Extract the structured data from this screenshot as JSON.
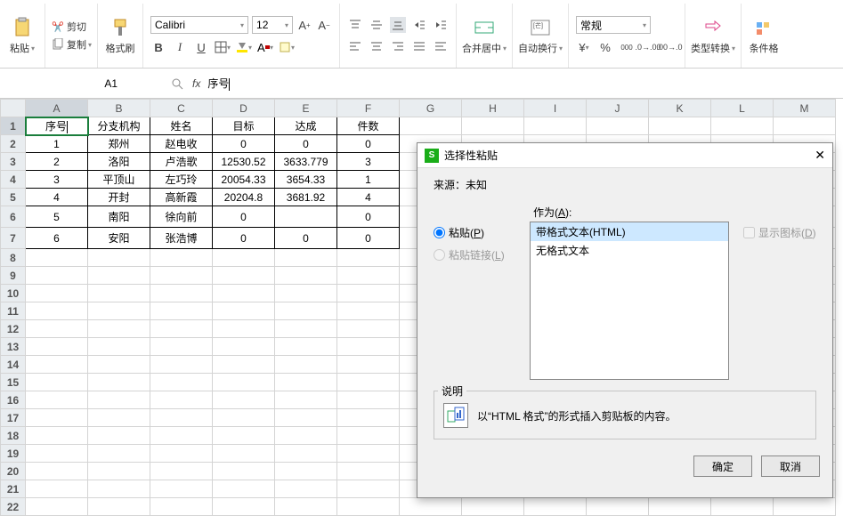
{
  "ribbon": {
    "paste_label": "粘贴",
    "cut_label": "剪切",
    "copy_label": "复制",
    "format_painter_label": "格式刷",
    "font_name": "Calibri",
    "font_size": "12",
    "merge_center_label": "合并居中",
    "wrap_text_label": "自动换行",
    "number_format_label": "常规",
    "type_convert_label": "类型转换",
    "cond_fmt_label": "条件格"
  },
  "name_box": {
    "value": "A1"
  },
  "formula_bar": {
    "value": "序号"
  },
  "columns": [
    "A",
    "B",
    "C",
    "D",
    "E",
    "F",
    "G",
    "H",
    "I",
    "J",
    "K",
    "L",
    "M"
  ],
  "row_numbers": [
    1,
    2,
    3,
    4,
    5,
    6,
    7,
    8,
    9,
    10,
    11,
    12,
    13,
    14,
    15,
    16,
    17,
    18,
    19,
    20,
    21,
    22
  ],
  "table": {
    "headers": [
      "序号",
      "分支机构",
      "姓名",
      "目标",
      "达成",
      "件数"
    ],
    "rows": [
      [
        "1",
        "郑州",
        "赵电收",
        "0",
        "0",
        "0"
      ],
      [
        "2",
        "洛阳",
        "卢浩歌",
        "12530.52",
        "3633.779",
        "3"
      ],
      [
        "3",
        "平顶山",
        "左巧玲",
        "20054.33",
        "3654.33",
        "1"
      ],
      [
        "4",
        "开封",
        "高新霞",
        "20204.8",
        "3681.92",
        "4"
      ],
      [
        "5",
        "南阳",
        "徐向前",
        "0",
        "",
        "0"
      ],
      [
        "6",
        "安阳",
        "张浩博",
        "0",
        "0",
        "0"
      ]
    ]
  },
  "dialog": {
    "title": "选择性粘贴",
    "source_label": "来源：",
    "source_value": "未知",
    "as_label_pre": "作为(",
    "as_label_key": "A",
    "as_label_post": "):",
    "radio_paste_pre": "粘贴(",
    "radio_paste_key": "P",
    "radio_paste_post": ")",
    "radio_paste_link_pre": "粘贴链接(",
    "radio_paste_link_key": "L",
    "radio_paste_link_post": ")",
    "options": [
      "带格式文本(HTML)",
      "无格式文本"
    ],
    "show_icon_pre": "显示图标(",
    "show_icon_key": "D",
    "show_icon_post": ")",
    "explain_heading": "说明",
    "explain_text": "以“HTML 格式”的形式插入剪贴板的内容。",
    "ok_label": "确定",
    "cancel_label": "取消"
  }
}
